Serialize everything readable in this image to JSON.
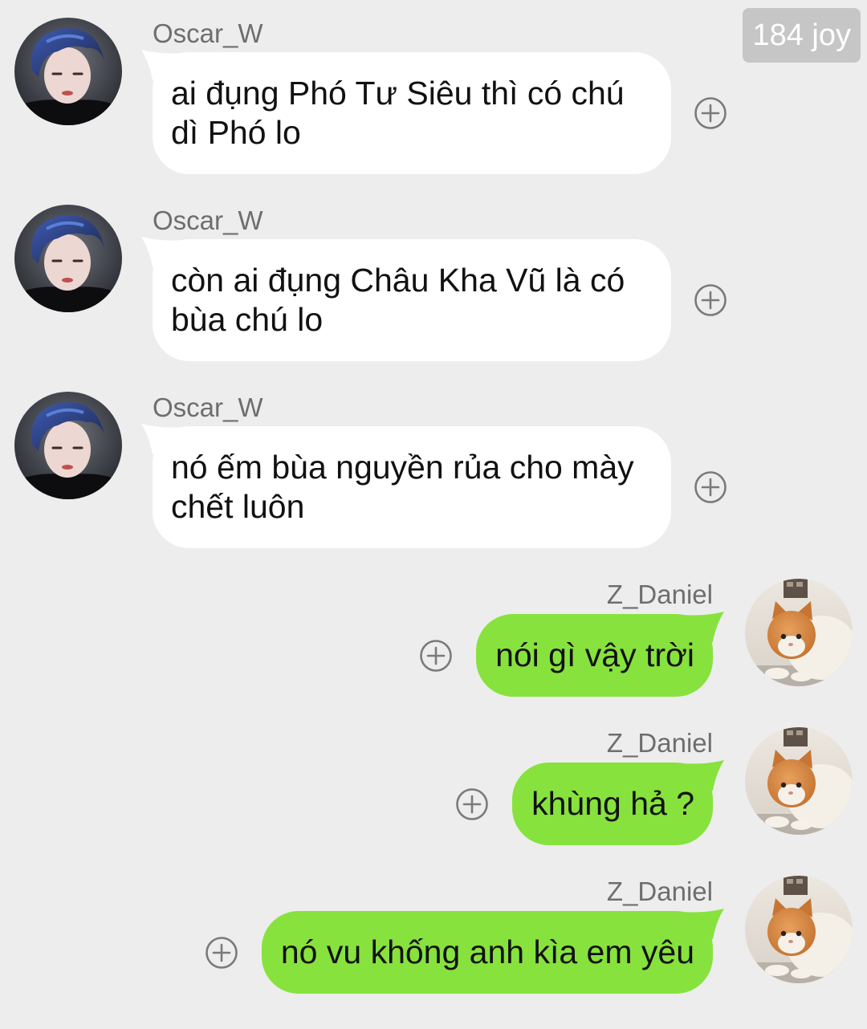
{
  "badge": {
    "label": "184 joy"
  },
  "colors": {
    "background": "#ededed",
    "received_bubble": "#ffffff",
    "sent_bubble": "#87e23d",
    "text": "#111111",
    "name": "#6e6e6e",
    "badge_bg": "#c6c6c6",
    "badge_text": "#ffffff",
    "icon": "#7a7a7a"
  },
  "messages": [
    {
      "sender": "Oscar_W",
      "text": "ai đụng Phó Tư Siêu thì có chú dì Phó lo",
      "outgoing": false,
      "avatar_icon": "oscar-w-avatar",
      "action_icon": "add-circle-icon"
    },
    {
      "sender": "Oscar_W",
      "text": "còn ai đụng Châu Kha Vũ là có bùa chú lo",
      "outgoing": false,
      "avatar_icon": "oscar-w-avatar",
      "action_icon": "add-circle-icon"
    },
    {
      "sender": "Oscar_W",
      "text": "nó ếm bùa nguyền rủa cho mày chết luôn",
      "outgoing": false,
      "avatar_icon": "oscar-w-avatar",
      "action_icon": "add-circle-icon"
    },
    {
      "sender": "Z_Daniel",
      "text": "nói gì vậy trời",
      "outgoing": true,
      "avatar_icon": "z-daniel-cat-avatar",
      "action_icon": "add-circle-icon"
    },
    {
      "sender": "Z_Daniel",
      "text": "khùng hả ?",
      "outgoing": true,
      "avatar_icon": "z-daniel-cat-avatar",
      "action_icon": "add-circle-icon"
    },
    {
      "sender": "Z_Daniel",
      "text": "nó vu khống anh kìa em yêu",
      "outgoing": true,
      "avatar_icon": "z-daniel-cat-avatar",
      "action_icon": "add-circle-icon"
    }
  ]
}
